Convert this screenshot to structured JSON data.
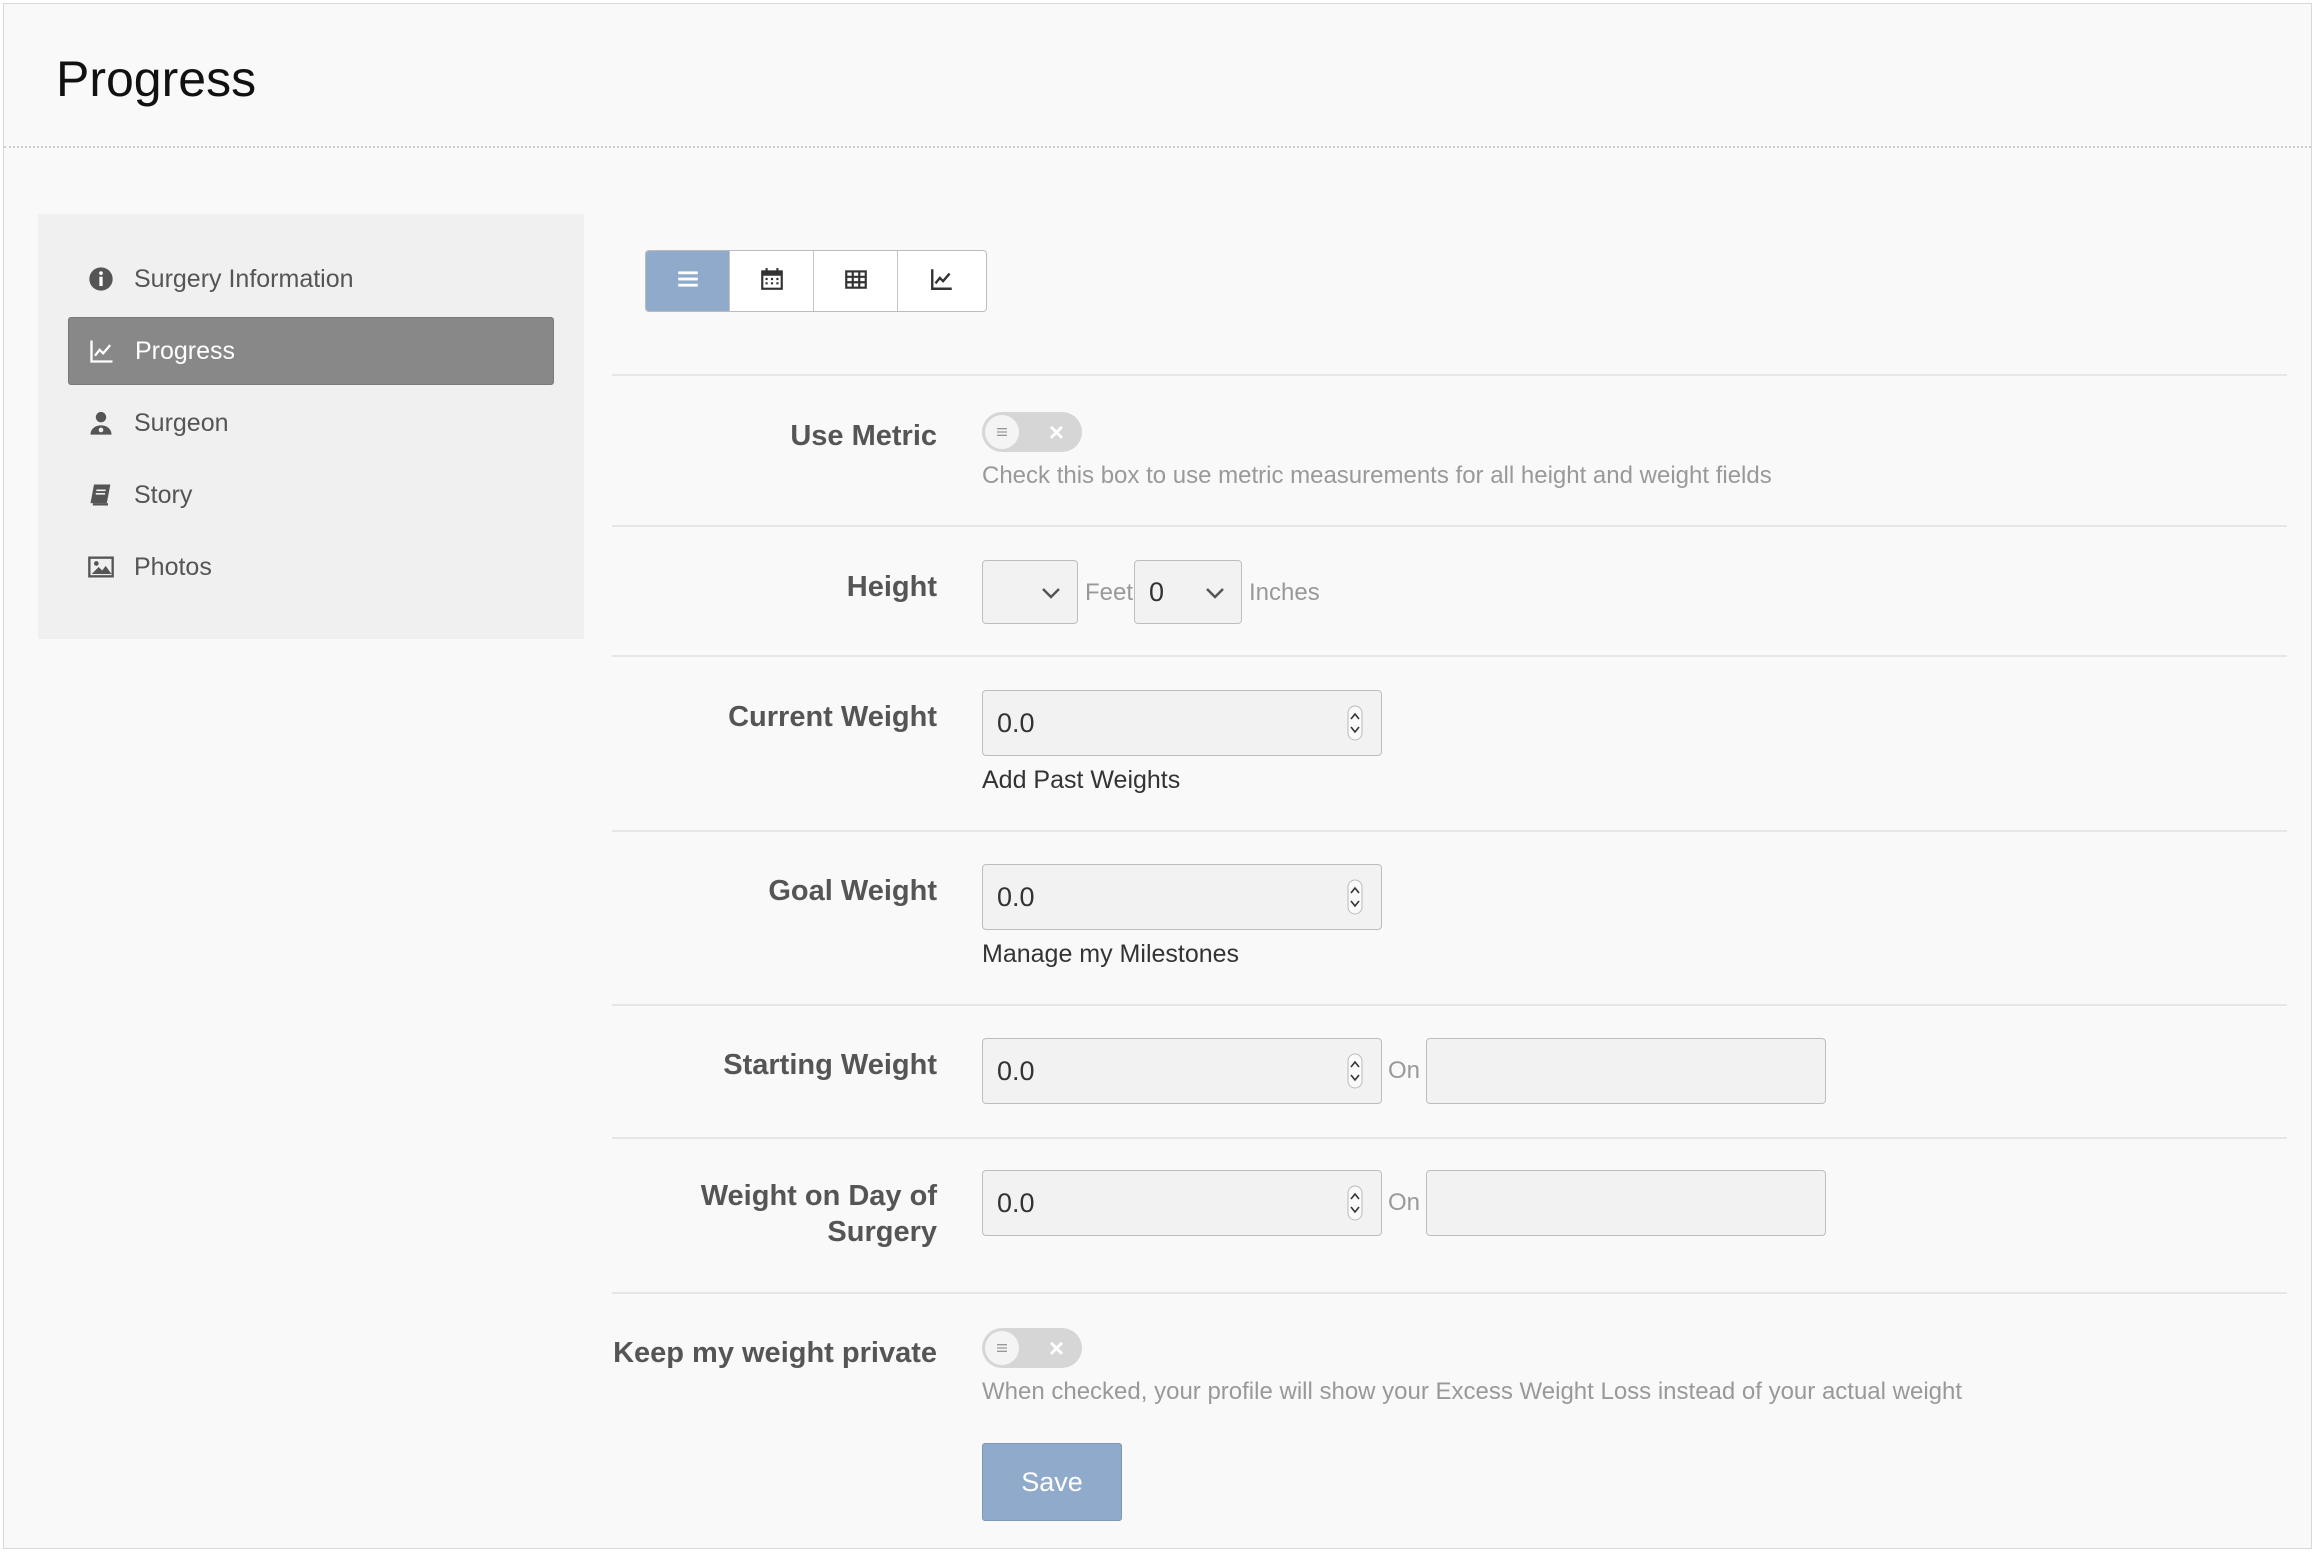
{
  "page": {
    "title": "Progress"
  },
  "sidebar": {
    "items": [
      {
        "label": "Surgery Information",
        "icon": "info-circle-icon",
        "active": false
      },
      {
        "label": "Progress",
        "icon": "line-chart-icon",
        "active": true
      },
      {
        "label": "Surgeon",
        "icon": "user-doctor-icon",
        "active": false
      },
      {
        "label": "Story",
        "icon": "book-icon",
        "active": false
      },
      {
        "label": "Photos",
        "icon": "image-icon",
        "active": false
      }
    ]
  },
  "view_toggle": {
    "buttons": [
      {
        "icon": "list-icon",
        "active": true
      },
      {
        "icon": "calendar-icon",
        "active": false
      },
      {
        "icon": "table-icon",
        "active": false
      },
      {
        "icon": "line-chart-icon",
        "active": false
      }
    ],
    "accent": "#90aacb"
  },
  "form": {
    "use_metric": {
      "label": "Use Metric",
      "help": "Check this box to use metric measurements for all height and weight fields",
      "checked": false
    },
    "height": {
      "label": "Height",
      "feet_value": "",
      "feet_unit": "Feet",
      "inches_value": "0",
      "inches_unit": "Inches"
    },
    "current_weight": {
      "label": "Current Weight",
      "value": "0.0",
      "link": "Add Past Weights"
    },
    "goal_weight": {
      "label": "Goal Weight",
      "value": "0.0",
      "link": "Manage my Milestones"
    },
    "starting_weight": {
      "label": "Starting Weight",
      "value": "0.0",
      "on_label": "On",
      "date": ""
    },
    "surgery_weight": {
      "label_line1": "Weight on Day of",
      "label_line2": "Surgery",
      "value": "0.0",
      "on_label": "On",
      "date": ""
    },
    "private": {
      "label": "Keep my weight private",
      "help": "When checked, your profile will show your Excess Weight Loss instead of your actual weight",
      "checked": false
    },
    "save_label": "Save"
  }
}
